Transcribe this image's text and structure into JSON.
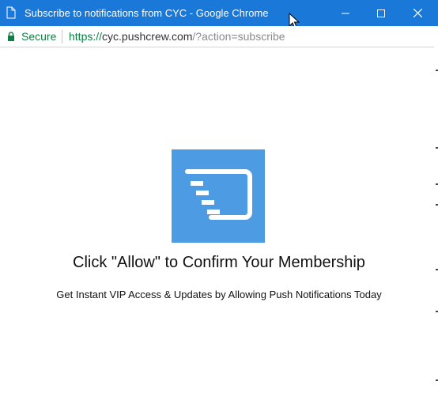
{
  "window": {
    "title": "Subscribe to notifications from CYC - Google Chrome",
    "accent_color": "#1a78d8",
    "controls": [
      "minimize-icon",
      "maximize-icon",
      "close-icon"
    ]
  },
  "address_bar": {
    "secure_label": "Secure",
    "url_scheme": "https://",
    "url_host": "cyc.pushcrew.com",
    "url_rest": "/?action=subscribe",
    "secure_color": "#0b8043"
  },
  "content": {
    "logo_icon": "pushcrew-logo-icon",
    "logo_color": "#4d9be3",
    "heading": "Click \"Allow\" to Confirm Your Membership",
    "subheading": "Get Instant VIP Access & Updates by Allowing Push Notifications Today"
  }
}
